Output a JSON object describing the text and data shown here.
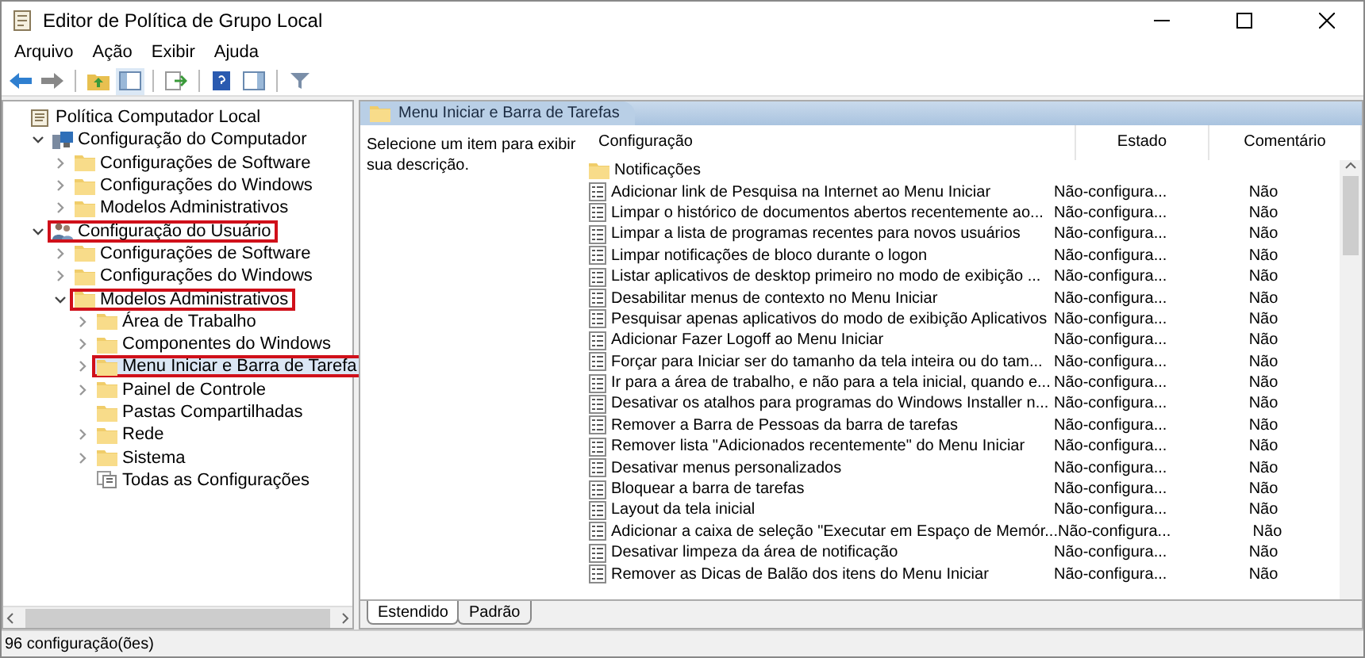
{
  "window": {
    "title": "Editor de Política de Grupo Local"
  },
  "menu": [
    "Arquivo",
    "Ação",
    "Exibir",
    "Ajuda"
  ],
  "tree": [
    {
      "label": "Política Computador Local",
      "kind": "policy",
      "selected": false,
      "highlighted": false,
      "children": [
        {
          "label": "Configuração do Computador",
          "kind": "computer",
          "expanded": true,
          "selected": false,
          "highlighted": false,
          "children": [
            {
              "label": "Configurações de Software",
              "kind": "folder",
              "expanded": false,
              "selected": false,
              "highlighted": false
            },
            {
              "label": "Configurações do Windows",
              "kind": "folder",
              "expanded": false,
              "selected": false,
              "highlighted": false
            },
            {
              "label": "Modelos Administrativos",
              "kind": "folder",
              "expanded": false,
              "selected": false,
              "highlighted": false
            }
          ]
        },
        {
          "label": "Configuração do Usuário",
          "kind": "user",
          "expanded": true,
          "selected": false,
          "highlighted": true,
          "children": [
            {
              "label": "Configurações de Software",
              "kind": "folder",
              "expanded": false,
              "selected": false,
              "highlighted": false
            },
            {
              "label": "Configurações do Windows",
              "kind": "folder",
              "expanded": false,
              "selected": false,
              "highlighted": false
            },
            {
              "label": "Modelos Administrativos",
              "kind": "folder",
              "expanded": true,
              "selected": false,
              "highlighted": true,
              "children": [
                {
                  "label": "Área de Trabalho",
                  "kind": "folder",
                  "expanded": false,
                  "selected": false,
                  "highlighted": false
                },
                {
                  "label": "Componentes do Windows",
                  "kind": "folder",
                  "expanded": false,
                  "selected": false,
                  "highlighted": false
                },
                {
                  "label": "Menu Iniciar e Barra de Tarefa",
                  "kind": "folder",
                  "expanded": false,
                  "selected": true,
                  "highlighted": true
                },
                {
                  "label": "Painel de Controle",
                  "kind": "folder",
                  "expanded": false,
                  "selected": false,
                  "highlighted": false
                },
                {
                  "label": "Pastas Compartilhadas",
                  "kind": "folder",
                  "selected": false,
                  "highlighted": false
                },
                {
                  "label": "Rede",
                  "kind": "folder",
                  "expanded": false,
                  "selected": false,
                  "highlighted": false
                },
                {
                  "label": "Sistema",
                  "kind": "folder",
                  "expanded": false,
                  "selected": false,
                  "highlighted": false
                },
                {
                  "label": "Todas as Configurações",
                  "kind": "all-settings",
                  "selected": false,
                  "highlighted": false
                }
              ]
            }
          ]
        }
      ]
    }
  ],
  "details": {
    "header": "Menu Iniciar e Barra de Tarefas",
    "description": "Selecione um item para exibir sua descrição."
  },
  "table": {
    "columns": [
      "Configuração",
      "Estado",
      "Comentário"
    ],
    "rows": [
      {
        "kind": "folder",
        "name": "Notificações"
      },
      {
        "kind": "setting",
        "name": "Adicionar link de Pesquisa na Internet ao Menu Iniciar",
        "state": "Não-configura...",
        "comment": "Não"
      },
      {
        "kind": "setting",
        "name": "Limpar o histórico de documentos abertos recentemente ao...",
        "state": "Não-configura...",
        "comment": "Não"
      },
      {
        "kind": "setting",
        "name": "Limpar a lista de programas recentes para novos usuários",
        "state": "Não-configura...",
        "comment": "Não"
      },
      {
        "kind": "setting",
        "name": "Limpar notificações de bloco durante o logon",
        "state": "Não-configura...",
        "comment": "Não"
      },
      {
        "kind": "setting",
        "name": "Listar aplicativos de desktop primeiro no modo de exibição ...",
        "state": "Não-configura...",
        "comment": "Não"
      },
      {
        "kind": "setting",
        "name": "Desabilitar menus de contexto no Menu Iniciar",
        "state": "Não-configura...",
        "comment": "Não"
      },
      {
        "kind": "setting",
        "name": "Pesquisar apenas aplicativos do modo de exibição Aplicativos",
        "state": "Não-configura...",
        "comment": "Não"
      },
      {
        "kind": "setting",
        "name": "Adicionar Fazer Logoff ao Menu Iniciar",
        "state": "Não-configura...",
        "comment": "Não"
      },
      {
        "kind": "setting",
        "name": "Forçar para Iniciar ser do tamanho da tela inteira ou do tam...",
        "state": "Não-configura...",
        "comment": "Não"
      },
      {
        "kind": "setting",
        "name": "Ir para a área de trabalho, e não para a tela inicial, quando e...",
        "state": "Não-configura...",
        "comment": "Não"
      },
      {
        "kind": "setting",
        "name": "Desativar os atalhos para programas do Windows Installer n...",
        "state": "Não-configura...",
        "comment": "Não"
      },
      {
        "kind": "setting",
        "name": "Remover a Barra de Pessoas da barra de tarefas",
        "state": "Não-configura...",
        "comment": "Não"
      },
      {
        "kind": "setting",
        "name": "Remover lista \"Adicionados recentemente\" do Menu Iniciar",
        "state": "Não-configura...",
        "comment": "Não"
      },
      {
        "kind": "setting",
        "name": "Desativar menus personalizados",
        "state": "Não-configura...",
        "comment": "Não"
      },
      {
        "kind": "setting",
        "name": "Bloquear a barra de tarefas",
        "state": "Não-configura...",
        "comment": "Não"
      },
      {
        "kind": "setting",
        "name": "Layout da tela inicial",
        "state": "Não-configura...",
        "comment": "Não"
      },
      {
        "kind": "setting",
        "name": "Adicionar a caixa de seleção \"Executar em Espaço de Memór...",
        "state": "Não-configura...",
        "comment": "Não"
      },
      {
        "kind": "setting",
        "name": "Desativar limpeza da área de notificação",
        "state": "Não-configura...",
        "comment": "Não"
      },
      {
        "kind": "setting",
        "name": "Remover as Dicas de Balão dos itens do Menu Iniciar",
        "state": "Não-configura...",
        "comment": "Não"
      }
    ]
  },
  "view_tabs": [
    {
      "label": "Estendido",
      "selected": true
    },
    {
      "label": "Padrão",
      "selected": false
    }
  ],
  "status_bar": "96 configuração(ões)"
}
